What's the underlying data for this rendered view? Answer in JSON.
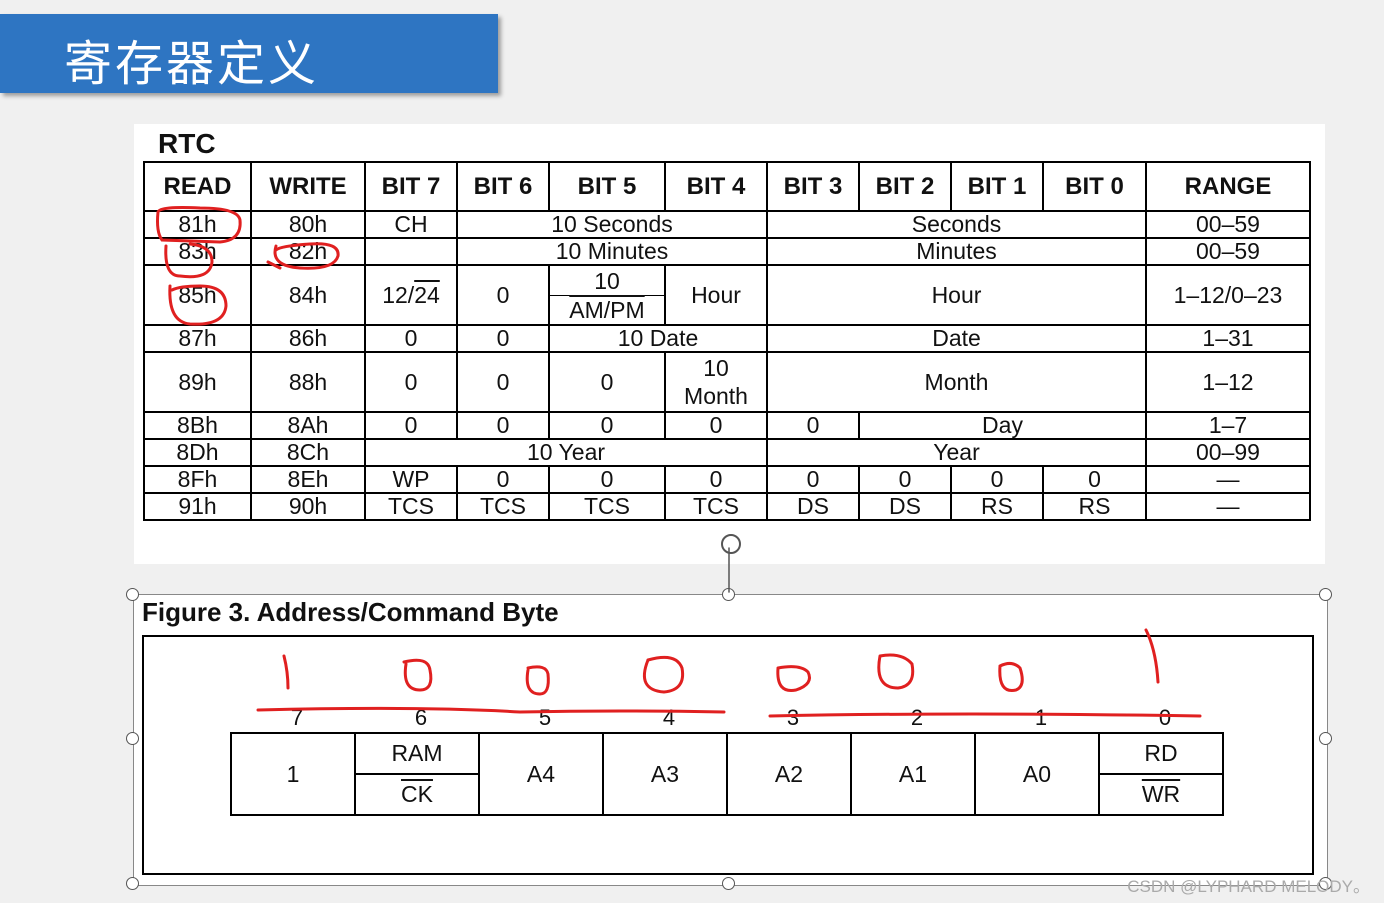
{
  "slide": {
    "title": "寄存器定义"
  },
  "rtc": {
    "label": "RTC",
    "headers": [
      "READ",
      "WRITE",
      "BIT 7",
      "BIT 6",
      "BIT 5",
      "BIT 4",
      "BIT 3",
      "BIT 2",
      "BIT 1",
      "BIT 0",
      "RANGE"
    ],
    "rows": [
      {
        "read": "81h",
        "write": "80h",
        "b7": "CH",
        "b6_4": "10 Seconds",
        "b3_0": "Seconds",
        "range": "00–59"
      },
      {
        "read": "83h",
        "write": "82h",
        "b7": "",
        "b6_4": "10 Minutes",
        "b3_0": "Minutes",
        "range": "00–59"
      },
      {
        "read": "85h",
        "write": "84h",
        "b7_a": "12/",
        "b7_b": "24",
        "b6": "0",
        "b5_top": "10",
        "b5_bot": "AM/PM",
        "b4": "Hour",
        "b3_0": "Hour",
        "range": "1–12/0–23"
      },
      {
        "read": "87h",
        "write": "86h",
        "b7": "0",
        "b6": "0",
        "b5_4": "10 Date",
        "b3_0": "Date",
        "range": "1–31"
      },
      {
        "read": "89h",
        "write": "88h",
        "b7": "0",
        "b6": "0",
        "b5": "0",
        "b4_top": "10",
        "b4_bot": "Month",
        "b3_0": "Month",
        "range": "1–12"
      },
      {
        "read": "8Bh",
        "write": "8Ah",
        "b7": "0",
        "b6": "0",
        "b5": "0",
        "b4": "0",
        "b3": "0",
        "b2_0": "Day",
        "range": "1–7"
      },
      {
        "read": "8Dh",
        "write": "8Ch",
        "b7_4": "10 Year",
        "b3_0": "Year",
        "range": "00–99"
      },
      {
        "read": "8Fh",
        "write": "8Eh",
        "b7": "WP",
        "b6": "0",
        "b5": "0",
        "b4": "0",
        "b3": "0",
        "b2": "0",
        "b1": "0",
        "b0": "0",
        "range": "—"
      },
      {
        "read": "91h",
        "write": "90h",
        "b7": "TCS",
        "b6": "TCS",
        "b5": "TCS",
        "b4": "TCS",
        "b3": "DS",
        "b2": "DS",
        "b1": "RS",
        "b0": "RS",
        "range": "—"
      }
    ]
  },
  "figure": {
    "title": "Figure 3. Address/Command Byte",
    "bit_numbers": [
      "7",
      "6",
      "5",
      "4",
      "3",
      "2",
      "1",
      "0"
    ],
    "cells": [
      {
        "label": "1"
      },
      {
        "top": "RAM",
        "bottom": "CK"
      },
      {
        "label": "A4"
      },
      {
        "label": "A3"
      },
      {
        "label": "A2"
      },
      {
        "label": "A1"
      },
      {
        "label": "A0"
      },
      {
        "top": "RD",
        "bottom": "WR"
      }
    ]
  },
  "watermark": "CSDN @LYPHARD MELODY。",
  "annotation_color": "#e02020"
}
